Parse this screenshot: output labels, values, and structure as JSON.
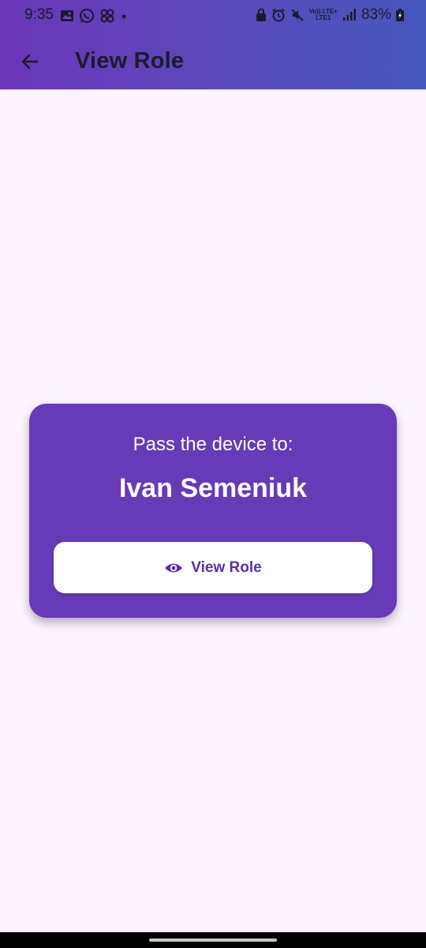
{
  "status_bar": {
    "time": "9:35",
    "left_icons": [
      "gallery-icon",
      "whatsapp-icon",
      "pinwheel-icon",
      "dot-icon"
    ],
    "right_icons": [
      "lock-icon",
      "alarm-icon",
      "mute-icon",
      "volte-icon",
      "signal-icon"
    ],
    "volte_line1": "Vo)) LTE+",
    "volte_line2": "LTE1",
    "battery": "83%"
  },
  "appbar": {
    "title": "View Role",
    "back_icon": "arrow-back-icon"
  },
  "card": {
    "pass_label": "Pass the device to:",
    "player_name": "Ivan Semeniuk",
    "button_label": "View Role",
    "button_icon": "eye-icon"
  },
  "colors": {
    "card": "#673ab7",
    "button_text": "#5a2fa8",
    "background": "#fcf5fd",
    "header_gradient_start": "#6a36b8",
    "header_gradient_end": "#4558bd"
  }
}
